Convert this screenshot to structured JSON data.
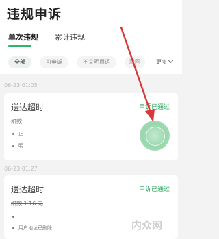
{
  "header": {
    "title": "违规申诉",
    "tabs": [
      {
        "label": "单次违规",
        "active": true
      },
      {
        "label": "累计违规",
        "active": false
      }
    ]
  },
  "filters": {
    "chips": [
      "全部",
      "可申诉",
      "不文明用语",
      "驳回"
    ],
    "more_label": "更多"
  },
  "records": [
    {
      "date": "06-23 01:05",
      "title": "送达超时",
      "status": "申诉已通过",
      "sub": "扣款",
      "rows": [
        "正",
        "明"
      ]
    },
    {
      "date": "06-23 01:27",
      "title": "送达超时",
      "status": "申诉已通过",
      "sub": "扣款 1.16 元",
      "rows": [
        "",
        "用户地址已删除"
      ]
    }
  ],
  "colors": {
    "accent": "#2eb56b",
    "status": "#2ea65d",
    "annotation_arrow": "#d9383a"
  },
  "watermark": "内众网"
}
